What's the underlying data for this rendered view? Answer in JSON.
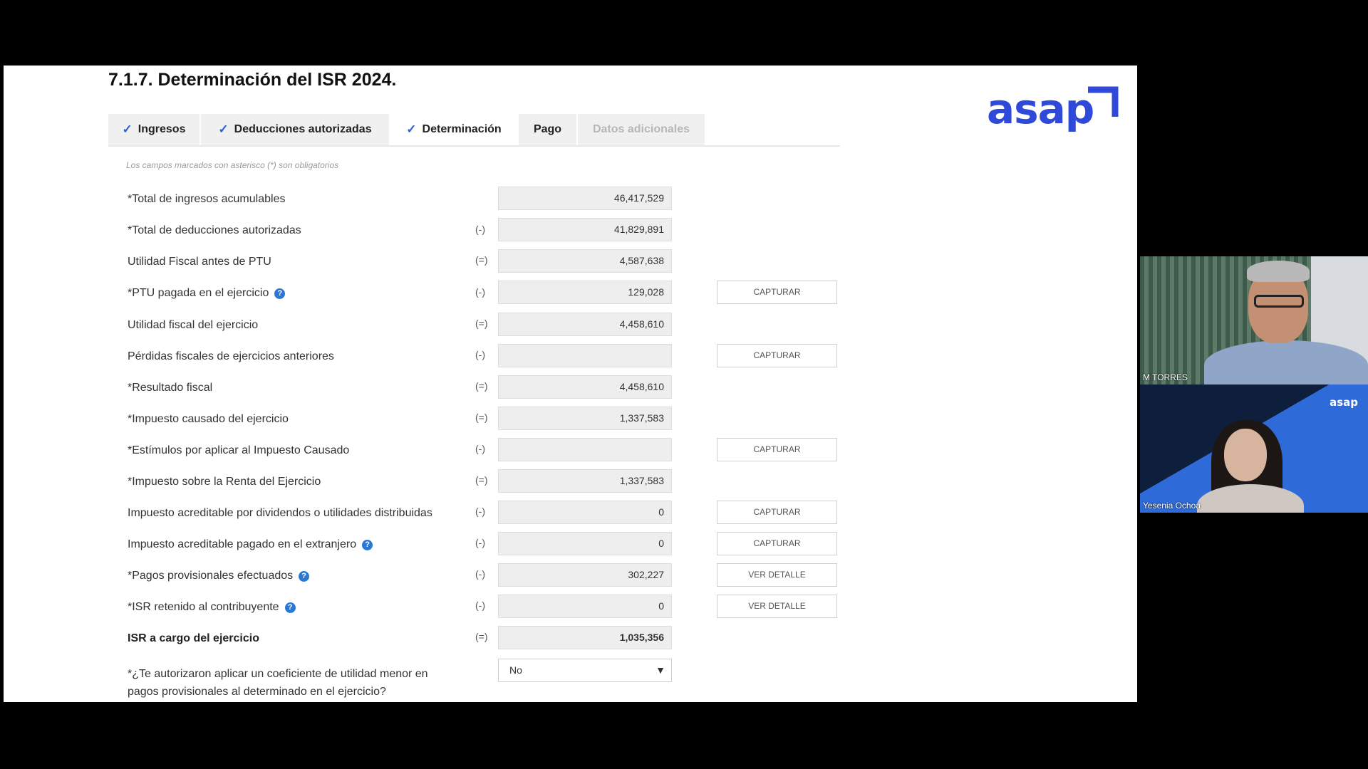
{
  "page": {
    "title": "7.1.7. Determinación del ISR 2024.",
    "brand": "asap",
    "brand_color": "#2f4ad8",
    "required_note": "Los campos marcados con asterisco (*) son obligatorios"
  },
  "tabs": [
    {
      "label": "Ingresos",
      "icon": "check-icon",
      "state": "done"
    },
    {
      "label": "Deducciones autorizadas",
      "icon": "check-icon",
      "state": "done"
    },
    {
      "label": "Determinación",
      "icon": "check-icon",
      "state": "active"
    },
    {
      "label": "Pago",
      "state": "normal"
    },
    {
      "label": "Datos adicionales",
      "state": "disabled"
    }
  ],
  "rows": [
    {
      "label": "*Total de ingresos acumulables",
      "op": "",
      "value": "46,417,529"
    },
    {
      "label": "*Total de deducciones autorizadas",
      "op": "(-)",
      "value": "41,829,891"
    },
    {
      "label": "Utilidad Fiscal antes de PTU",
      "op": "(=)",
      "value": "4,587,638"
    },
    {
      "label": "*PTU pagada en el ejercicio",
      "op": "(-)",
      "value": "129,028",
      "help": true,
      "action": "CAPTURAR"
    },
    {
      "label": "Utilidad fiscal del ejercicio",
      "op": "(=)",
      "value": "4,458,610"
    },
    {
      "label": "Pérdidas fiscales de ejercicios anteriores",
      "op": "(-)",
      "value": "",
      "action": "CAPTURAR"
    },
    {
      "label": "*Resultado fiscal",
      "op": "(=)",
      "value": "4,458,610"
    },
    {
      "label": "*Impuesto causado del ejercicio",
      "op": "(=)",
      "value": "1,337,583"
    },
    {
      "label": "*Estímulos por aplicar al Impuesto Causado",
      "op": "(-)",
      "value": "",
      "action": "CAPTURAR"
    },
    {
      "label": "*Impuesto sobre la Renta del Ejercicio",
      "op": "(=)",
      "value": "1,337,583"
    },
    {
      "label": "Impuesto acreditable por dividendos o utilidades distribuidas",
      "op": "(-)",
      "value": "0",
      "action": "CAPTURAR"
    },
    {
      "label": "Impuesto acreditable pagado en el extranjero",
      "op": "(-)",
      "value": "0",
      "help": true,
      "action": "CAPTURAR"
    },
    {
      "label": "*Pagos provisionales efectuados",
      "op": "(-)",
      "value": "302,227",
      "help": true,
      "action": "VER DETALLE"
    },
    {
      "label": "*ISR retenido al contribuyente",
      "op": "(-)",
      "value": "0",
      "help": true,
      "action": "VER DETALLE"
    },
    {
      "label": "ISR a cargo del ejercicio",
      "op": "(=)",
      "value": "1,035,356",
      "bold": true
    }
  ],
  "question": {
    "label": "*¿Te autorizaron aplicar un coeficiente de utilidad menor en pagos provisionales al determinado en el ejercicio?",
    "selected": "No"
  },
  "participants": [
    {
      "name": "M TORRES"
    },
    {
      "name": "Yesenia Ochoa",
      "logo": "asap"
    }
  ]
}
